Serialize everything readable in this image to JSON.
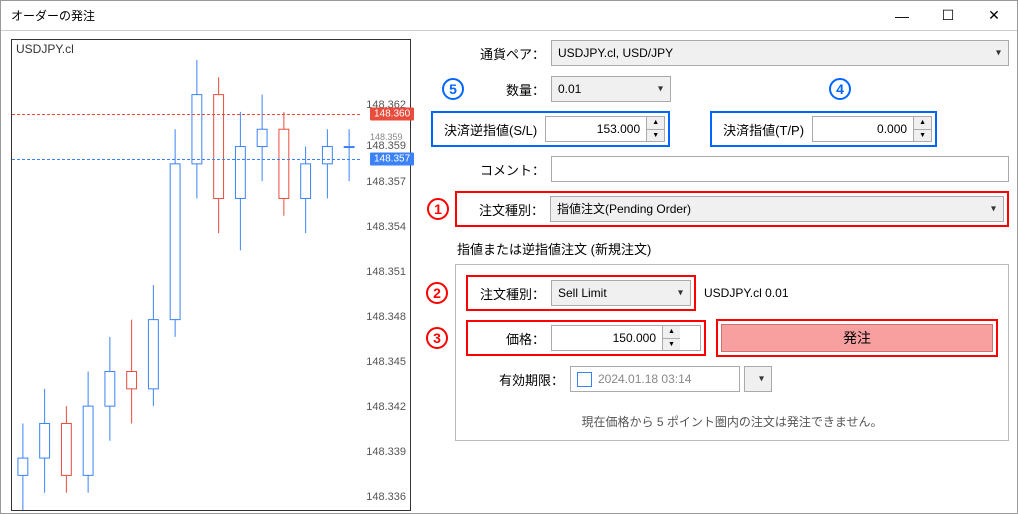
{
  "window": {
    "title": "オーダーの発注"
  },
  "chart": {
    "symbol": "USDJPY.cl",
    "ask_price": "148.360",
    "bid_price": "148.357",
    "mid_price": "148.359",
    "ylabels": [
      "148.362",
      "148.359",
      "148.357",
      "148.354",
      "148.351",
      "148.348",
      "148.345",
      "148.342",
      "148.339",
      "148.336"
    ]
  },
  "form": {
    "pair_label": "通貨ペア：",
    "pair_value": "USDJPY.cl, USD/JPY",
    "volume_label": "数量：",
    "volume_value": "0.01",
    "sl_label": "決済逆指値(S/L)",
    "sl_value": "153.000",
    "tp_label": "決済指値(T/P)",
    "tp_value": "0.000",
    "comment_label": "コメント：",
    "comment_value": "",
    "order_class_label": "注文種別：",
    "order_class_value": "指値注文(Pending Order)",
    "pending": {
      "legend": "指値または逆指値注文 (新規注文)",
      "type_label": "注文種別：",
      "type_value": "Sell Limit",
      "symbol_info": "USDJPY.cl 0.01",
      "price_label": "価格：",
      "price_value": "150.000",
      "submit_label": "発注",
      "expiry_label": "有効期限：",
      "expiry_value": "2024.01.18 03:14"
    },
    "info": "現在価格から 5 ポイント圏内の注文は発注できません。"
  },
  "annotations": {
    "n1": "1",
    "n2": "2",
    "n3": "3",
    "n4": "4",
    "n5": "5"
  },
  "chart_data": {
    "type": "candlestick",
    "symbol": "USDJPY.cl",
    "ylim": [
      148.336,
      148.362
    ],
    "ask": 148.36,
    "bid": 148.357,
    "note": "approximate OHLC read from pixels, ~30 bars",
    "bars": [
      {
        "o": 148.338,
        "h": 148.341,
        "l": 148.336,
        "c": 148.339
      },
      {
        "o": 148.339,
        "h": 148.343,
        "l": 148.337,
        "c": 148.341
      },
      {
        "o": 148.341,
        "h": 148.342,
        "l": 148.337,
        "c": 148.338
      },
      {
        "o": 148.338,
        "h": 148.344,
        "l": 148.337,
        "c": 148.342
      },
      {
        "o": 148.342,
        "h": 148.346,
        "l": 148.34,
        "c": 148.344
      },
      {
        "o": 148.344,
        "h": 148.347,
        "l": 148.341,
        "c": 148.343
      },
      {
        "o": 148.343,
        "h": 148.349,
        "l": 148.342,
        "c": 148.347
      },
      {
        "o": 148.347,
        "h": 148.358,
        "l": 148.346,
        "c": 148.356
      },
      {
        "o": 148.356,
        "h": 148.362,
        "l": 148.354,
        "c": 148.36
      },
      {
        "o": 148.36,
        "h": 148.361,
        "l": 148.352,
        "c": 148.354
      },
      {
        "o": 148.354,
        "h": 148.359,
        "l": 148.351,
        "c": 148.357
      },
      {
        "o": 148.357,
        "h": 148.36,
        "l": 148.355,
        "c": 148.358
      },
      {
        "o": 148.358,
        "h": 148.359,
        "l": 148.353,
        "c": 148.354
      },
      {
        "o": 148.354,
        "h": 148.357,
        "l": 148.352,
        "c": 148.356
      },
      {
        "o": 148.356,
        "h": 148.358,
        "l": 148.354,
        "c": 148.357
      },
      {
        "o": 148.357,
        "h": 148.358,
        "l": 148.355,
        "c": 148.357
      }
    ]
  }
}
